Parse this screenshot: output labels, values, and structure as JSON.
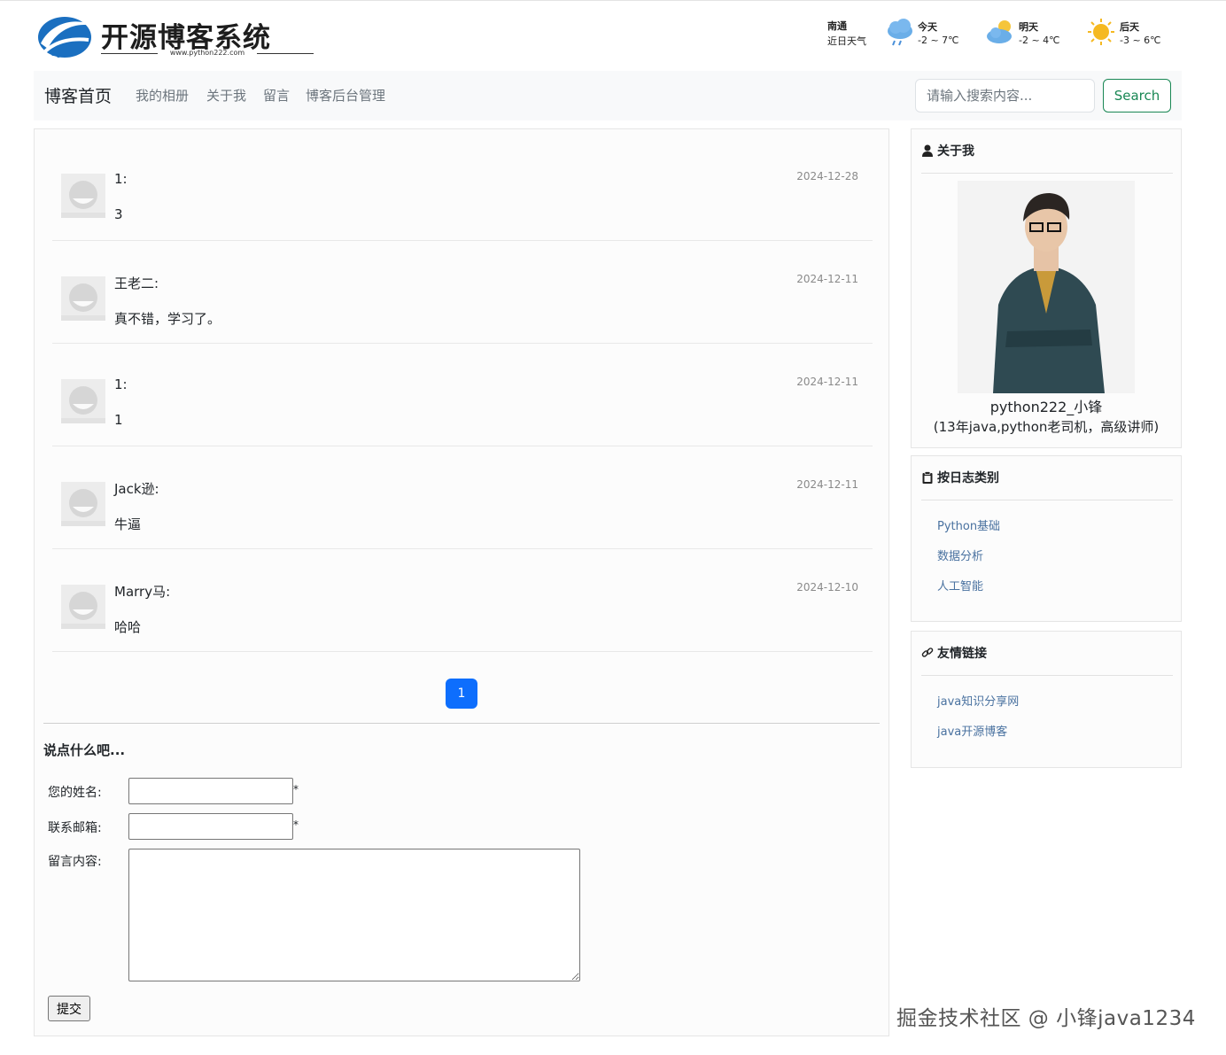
{
  "logo": {
    "title": "开源博客系统",
    "url": "www.python222.com"
  },
  "weather": {
    "city": "南通",
    "caption": "近日天气",
    "days": [
      {
        "name": "今天",
        "temp": "-2 ~ 7℃",
        "icon": "cloud-rain-icon"
      },
      {
        "name": "明天",
        "temp": "-2 ~ 4℃",
        "icon": "partly-cloudy-icon"
      },
      {
        "name": "后天",
        "temp": "-3 ~ 6℃",
        "icon": "sun-icon"
      }
    ]
  },
  "nav": {
    "brand": "博客首页",
    "links": [
      "我的相册",
      "关于我",
      "留言",
      "博客后台管理"
    ],
    "search_placeholder": "请输入搜索内容...",
    "search_button": "Search"
  },
  "comments": [
    {
      "name": "1:",
      "text": "3",
      "date": "2024-12-28"
    },
    {
      "name": "王老二:",
      "text": "真不错，学习了。",
      "date": "2024-12-11"
    },
    {
      "name": "1:",
      "text": "1",
      "date": "2024-12-11"
    },
    {
      "name": "Jack逊:",
      "text": "牛逼",
      "date": "2024-12-11"
    },
    {
      "name": "Marry马:",
      "text": "哈哈",
      "date": "2024-12-10"
    }
  ],
  "pagination": {
    "current": "1"
  },
  "form": {
    "title": "说点什么吧...",
    "name_label": "您的姓名:",
    "email_label": "联系邮箱:",
    "content_label": "留言内容:",
    "required_mark": "*",
    "submit": "提交"
  },
  "sidebar": {
    "about": {
      "title": "关于我",
      "name": "python222_小锋",
      "desc": "(13年java,python老司机，高级讲师)"
    },
    "categories": {
      "title": "按日志类别",
      "items": [
        "Python基础",
        "数据分析",
        "人工智能"
      ]
    },
    "links": {
      "title": "友情链接",
      "items": [
        "java知识分享网",
        "java开源博客"
      ]
    }
  },
  "watermark": "掘金技术社区 @ 小锋java1234",
  "colors": {
    "primary": "#0d6efd",
    "success": "#198754",
    "link": "#4a72a0"
  }
}
